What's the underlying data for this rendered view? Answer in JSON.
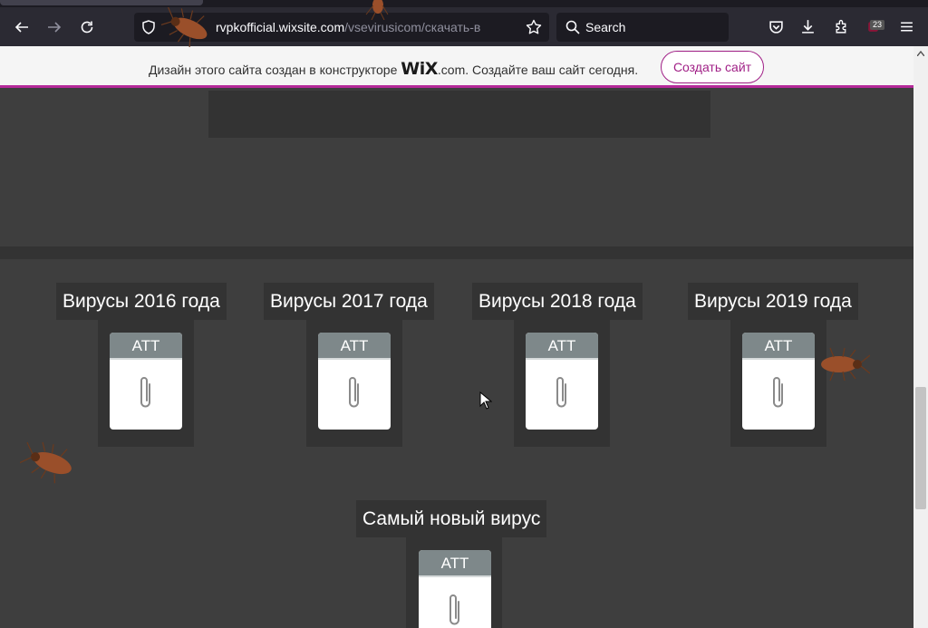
{
  "browser": {
    "url_host": "rvpkofficial.wixsite.com",
    "url_path": "/vsevirusicom/скачать-в",
    "search_placeholder": "Search",
    "extension_badge": "23",
    "icons": [
      "back-icon",
      "forward-icon",
      "reload-icon",
      "shield-icon",
      "star-icon",
      "search-icon",
      "pocket-icon",
      "download-icon",
      "extensions-icon",
      "menu-icon"
    ]
  },
  "wix_banner": {
    "text_before": "Дизайн этого сайта создан в конструкторе ",
    "logo": "WiX",
    "text_after": ".com. Создайте ваш сайт сегодня.",
    "button": "Создать сайт",
    "accent_color": "#a01f86"
  },
  "page": {
    "background_color": "#3e3e3e",
    "cards": [
      {
        "title": "Вирусы 2016 года",
        "attachment_label": "ATT"
      },
      {
        "title": "Вирусы 2017 года",
        "attachment_label": "ATT"
      },
      {
        "title": "Вирусы 2018 года",
        "attachment_label": "ATT"
      },
      {
        "title": "Вирусы 2019 года",
        "attachment_label": "ATT"
      },
      {
        "title": "Самый новый вирус",
        "attachment_label": "ATT"
      }
    ]
  }
}
